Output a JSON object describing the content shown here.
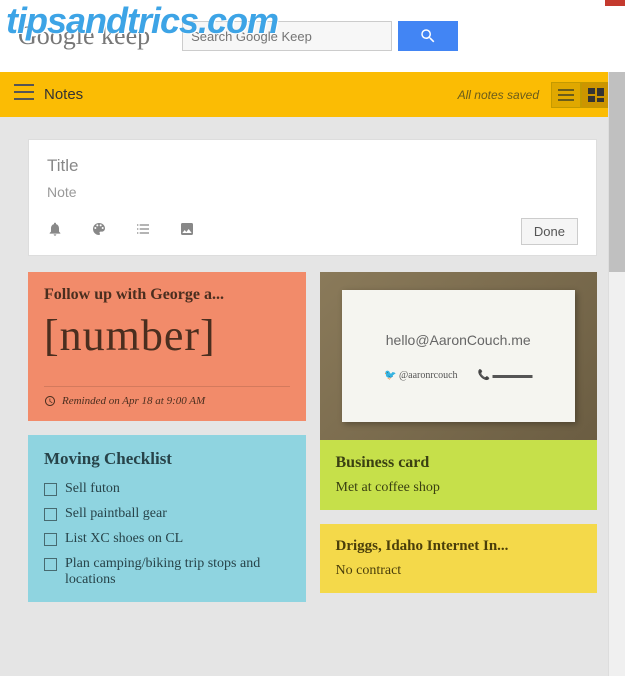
{
  "watermark": "tipsandtrics.com",
  "header": {
    "logo": "Google keep",
    "search_placeholder": "Search Google Keep"
  },
  "toolbar": {
    "title": "Notes",
    "status": "All notes saved"
  },
  "compose": {
    "title_placeholder": "Title",
    "note_placeholder": "Note",
    "done_label": "Done"
  },
  "notes": {
    "followup": {
      "title": "Follow up with George a...",
      "body": "[number]",
      "reminder": "Reminded on Apr 18 at 9:00 AM"
    },
    "moving": {
      "title": "Moving Checklist",
      "items": [
        "Sell futon",
        "Sell paintball gear",
        "List XC shoes on CL",
        "Plan camping/biking trip stops and locations"
      ]
    },
    "bizcard": {
      "email": "hello@AaronCouch.me",
      "twitter": "@aaronrcouch",
      "title": "Business card",
      "body": "Met at coffee shop"
    },
    "driggs": {
      "title": "Driggs, Idaho Internet In...",
      "body": "No contract"
    }
  }
}
